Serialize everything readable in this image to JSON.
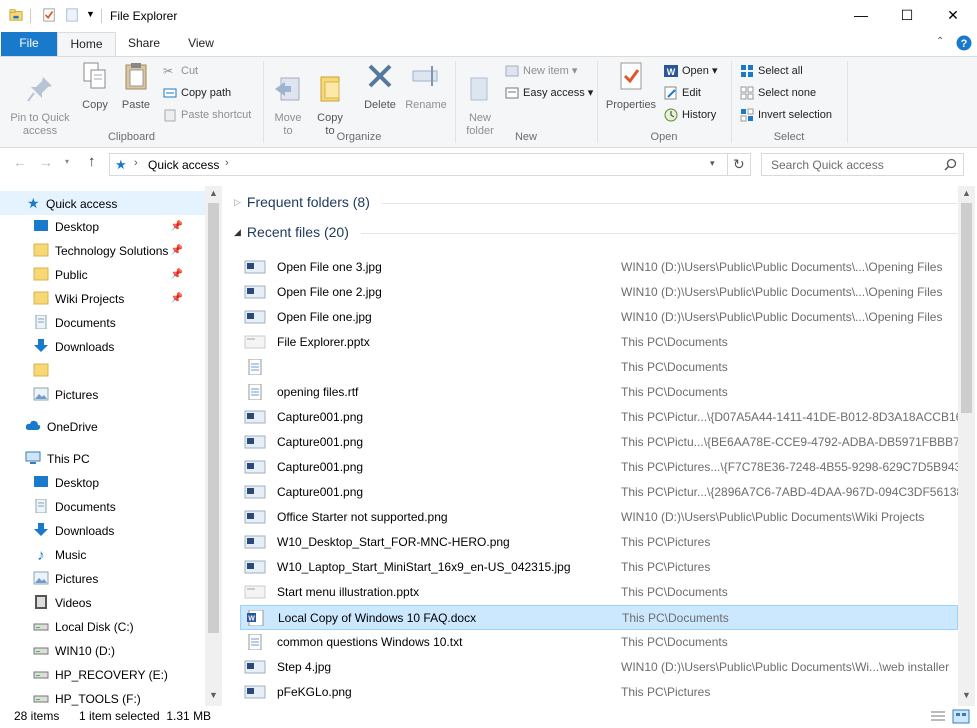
{
  "window": {
    "title": "File Explorer",
    "controls": {
      "minimize": "—",
      "maximize": "☐",
      "close": "✕"
    }
  },
  "tabs": [
    {
      "label": "File"
    },
    {
      "label": "Home"
    },
    {
      "label": "Share"
    },
    {
      "label": "View"
    }
  ],
  "ribbon": {
    "clipboard": {
      "label": "Clipboard",
      "pin": "Pin to Quick\naccess",
      "copy": "Copy",
      "paste": "Paste",
      "cut": "Cut",
      "copy_path": "Copy path",
      "paste_shortcut": "Paste shortcut"
    },
    "organize": {
      "label": "Organize",
      "move_to": "Move\nto",
      "copy_to": "Copy\nto",
      "delete": "Delete",
      "rename": "Rename"
    },
    "new": {
      "label": "New",
      "new_folder": "New\nfolder",
      "new_item": "New item",
      "easy_access": "Easy access"
    },
    "open": {
      "label": "Open",
      "properties": "Properties",
      "open": "Open",
      "edit": "Edit",
      "history": "History"
    },
    "select": {
      "label": "Select",
      "select_all": "Select all",
      "select_none": "Select none",
      "invert_selection": "Invert selection"
    }
  },
  "address": {
    "path": "Quick access",
    "search_placeholder": "Search Quick access"
  },
  "nav": {
    "quick_access": "Quick access",
    "quick_items": [
      {
        "label": "Desktop",
        "pinned": true
      },
      {
        "label": "Technology Solutions",
        "pinned": true
      },
      {
        "label": "Public",
        "pinned": true
      },
      {
        "label": "Wiki Projects",
        "pinned": true
      },
      {
        "label": "Documents",
        "pinned": false
      },
      {
        "label": "Downloads",
        "pinned": false
      },
      {
        "label": "",
        "pinned": false
      },
      {
        "label": "Pictures",
        "pinned": false
      }
    ],
    "onedrive": "OneDrive",
    "this_pc": "This PC",
    "pc_items": [
      {
        "label": "Desktop"
      },
      {
        "label": "Documents"
      },
      {
        "label": "Downloads"
      },
      {
        "label": "Music"
      },
      {
        "label": "Pictures"
      },
      {
        "label": "Videos"
      },
      {
        "label": "Local Disk (C:)"
      },
      {
        "label": "WIN10 (D:)"
      },
      {
        "label": "HP_RECOVERY (E:)"
      },
      {
        "label": "HP_TOOLS (F:)"
      }
    ]
  },
  "content": {
    "frequent_header": "Frequent folders (8)",
    "recent_header": "Recent files (20)",
    "files": [
      {
        "name": "Open File one 3.jpg",
        "location": "WIN10 (D:)\\Users\\Public\\Public Documents\\...\\Opening Files"
      },
      {
        "name": "Open File one 2.jpg",
        "location": "WIN10 (D:)\\Users\\Public\\Public Documents\\...\\Opening Files"
      },
      {
        "name": "Open File one.jpg",
        "location": "WIN10 (D:)\\Users\\Public\\Public Documents\\...\\Opening Files"
      },
      {
        "name": "File Explorer.pptx",
        "location": "This PC\\Documents"
      },
      {
        "name": "",
        "location": "This PC\\Documents"
      },
      {
        "name": "opening files.rtf",
        "location": "This PC\\Documents"
      },
      {
        "name": "Capture001.png",
        "location": "This PC\\Pictur...\\{D07A5A44-1411-41DE-B012-8D3A18ACCB16}"
      },
      {
        "name": "Capture001.png",
        "location": "This PC\\Pictu...\\{BE6AA78E-CCE9-4792-ADBA-DB5971FBBB72}"
      },
      {
        "name": "Capture001.png",
        "location": "This PC\\Pictures...\\{F7C78E36-7248-4B55-9298-629C7D5B9431}"
      },
      {
        "name": "Capture001.png",
        "location": "This PC\\Pictur...\\{2896A7C6-7ABD-4DAA-967D-094C3DF56138}"
      },
      {
        "name": "Office Starter not supported.png",
        "location": "WIN10 (D:)\\Users\\Public\\Public Documents\\Wiki Projects"
      },
      {
        "name": "W10_Desktop_Start_FOR-MNC-HERO.png",
        "location": "This PC\\Pictures"
      },
      {
        "name": "W10_Laptop_Start_MiniStart_16x9_en-US_042315.jpg",
        "location": "This PC\\Pictures"
      },
      {
        "name": "Start menu illustration.pptx",
        "location": "This PC\\Documents"
      },
      {
        "name": "Local Copy of Windows 10 FAQ.docx",
        "location": "This PC\\Documents",
        "selected": true
      },
      {
        "name": "common questions Windows 10.txt",
        "location": "This PC\\Documents"
      },
      {
        "name": "Step 4.jpg",
        "location": "WIN10 (D:)\\Users\\Public\\Public Documents\\Wi...\\web installer"
      },
      {
        "name": "pFeKGLo.png",
        "location": "This PC\\Pictures"
      }
    ]
  },
  "status": {
    "items": "28 items",
    "selected": "1 item selected  1.31 MB"
  },
  "colors": {
    "accent": "#1979ca",
    "selection": "#cce8ff",
    "section_header": "#1e395b",
    "folder": "#f8d775"
  }
}
